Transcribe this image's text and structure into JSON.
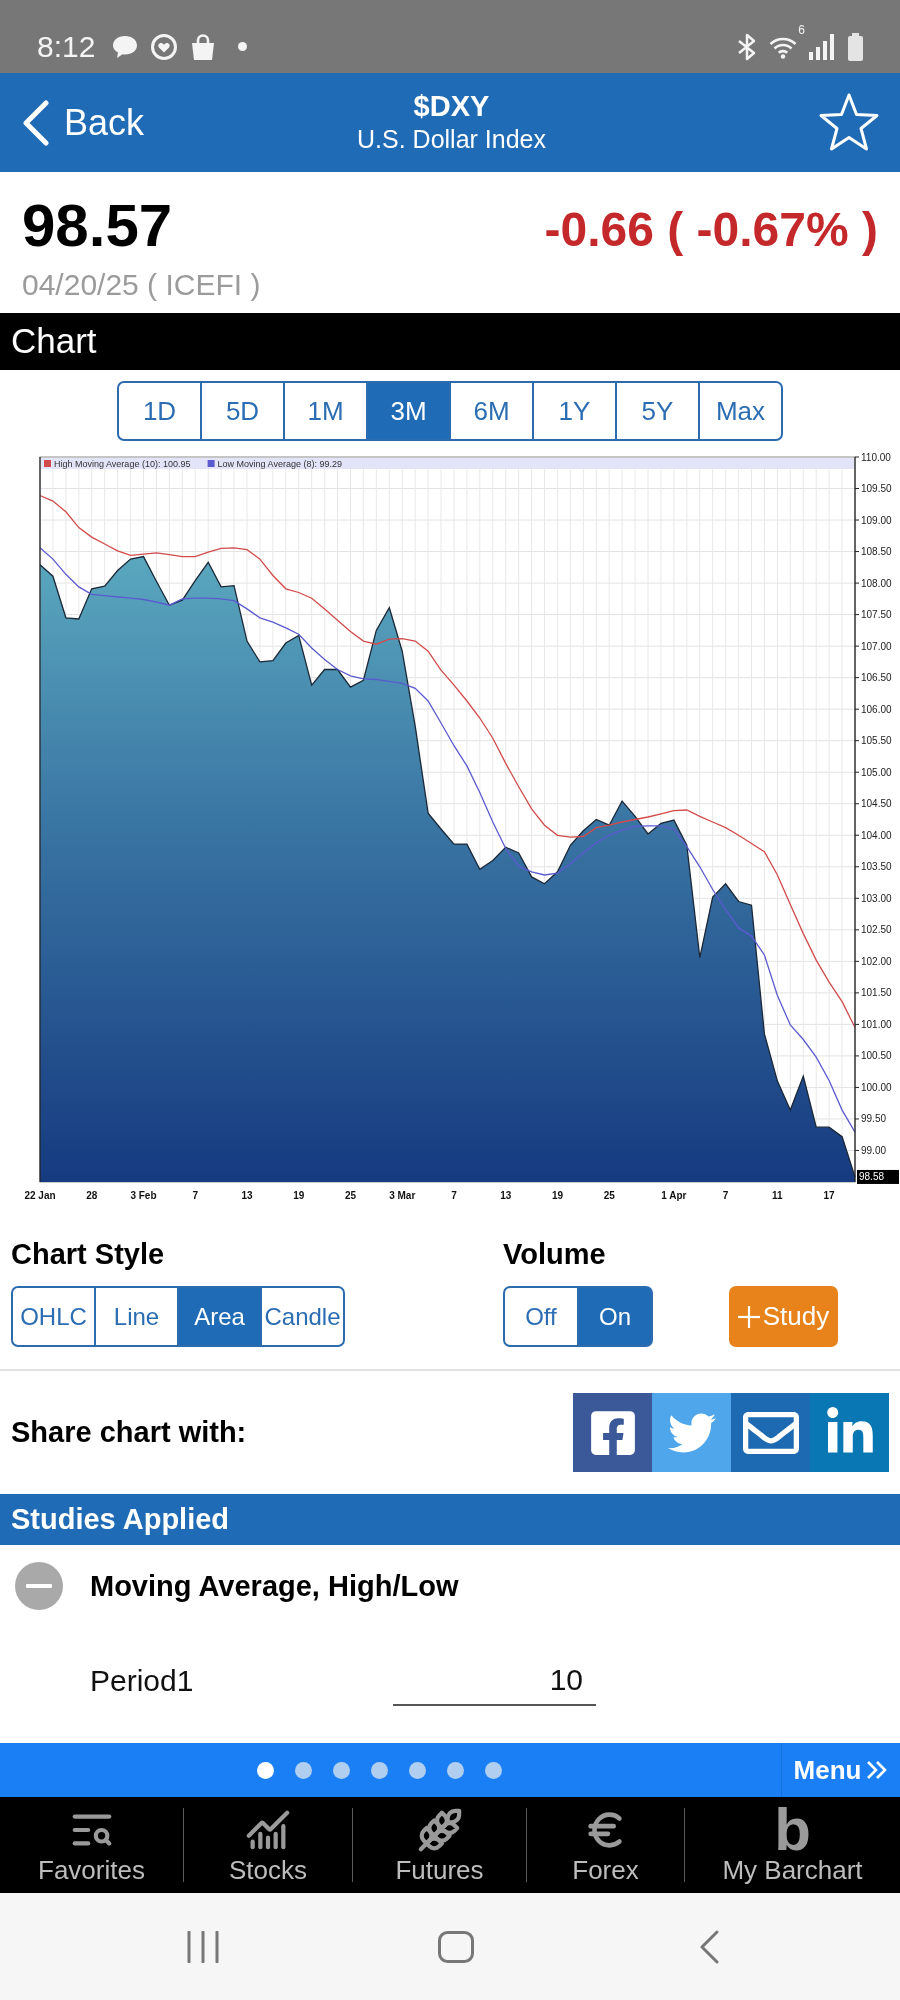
{
  "status_bar": {
    "time": "8:12",
    "wifi_badge": "6"
  },
  "header": {
    "back_label": "Back",
    "symbol": "$DXY",
    "name": "U.S. Dollar Index",
    "favorite": false
  },
  "quote": {
    "price": "98.57",
    "change": "-0.66 ( -0.67% )",
    "negative": true,
    "date_source": "04/20/25 ( ICEFI )"
  },
  "section_title": "Chart",
  "ranges": [
    {
      "label": "1D",
      "selected": false
    },
    {
      "label": "5D",
      "selected": false
    },
    {
      "label": "1M",
      "selected": false
    },
    {
      "label": "3M",
      "selected": true
    },
    {
      "label": "6M",
      "selected": false
    },
    {
      "label": "1Y",
      "selected": false
    },
    {
      "label": "5Y",
      "selected": false
    },
    {
      "label": "Max",
      "selected": false
    }
  ],
  "chart": {
    "chart_data": {
      "type": "area",
      "categories": [
        "22 Jan",
        null,
        null,
        null,
        "28",
        null,
        null,
        null,
        "3 Feb",
        null,
        null,
        null,
        "7",
        null,
        null,
        null,
        "13",
        null,
        null,
        null,
        "19",
        null,
        null,
        null,
        "25",
        null,
        null,
        null,
        "3 Mar",
        null,
        null,
        null,
        "7",
        null,
        null,
        null,
        "13",
        null,
        null,
        null,
        "19",
        null,
        null,
        null,
        "25",
        null,
        null,
        null,
        null,
        "1 Apr",
        null,
        null,
        null,
        "7",
        null,
        null,
        null,
        "11",
        null,
        null,
        null,
        "17",
        null,
        null
      ],
      "series": [
        {
          "values": [
            108.29,
            108.11,
            107.45,
            107.43,
            107.91,
            107.95,
            108.2,
            108.38,
            108.42,
            108.03,
            107.65,
            107.73,
            108.04,
            108.33,
            107.94,
            107.96,
            107.08,
            106.75,
            106.77,
            107.05,
            107.17,
            106.38,
            106.63,
            106.63,
            106.35,
            106.46,
            107.25,
            107.61,
            106.92,
            105.73,
            104.35,
            104.1,
            103.86,
            103.86,
            103.46,
            103.6,
            103.81,
            103.72,
            103.34,
            103.23,
            103.42,
            103.84,
            104.07,
            104.25,
            104.16,
            104.54,
            104.3,
            104.02,
            104.19,
            104.24,
            103.84,
            102.06,
            103.02,
            103.23,
            102.95,
            102.89,
            100.85,
            100.1,
            99.64,
            100.18,
            99.37,
            99.37,
            99.22,
            98.58
          ]
        },
        {
          "type": "line",
          "name": "High Moving Average (10): 100.95",
          "color": "#d24b4b",
          "values": [
            109.39,
            109.3,
            109.13,
            108.88,
            108.73,
            108.62,
            108.51,
            108.44,
            108.46,
            108.48,
            108.45,
            108.42,
            108.42,
            108.49,
            108.55,
            108.56,
            108.53,
            108.38,
            108.12,
            107.91,
            107.85,
            107.76,
            107.59,
            107.41,
            107.23,
            107.08,
            107.03,
            107.11,
            107.12,
            107.08,
            106.92,
            106.62,
            106.38,
            106.13,
            105.86,
            105.54,
            105.14,
            104.77,
            104.42,
            104.16,
            104.0,
            103.97,
            103.98,
            104.12,
            104.16,
            104.21,
            104.25,
            104.29,
            104.34,
            104.39,
            104.4,
            104.3,
            104.21,
            104.12,
            104.0,
            103.87,
            103.74,
            103.37,
            102.9,
            102.44,
            102.02,
            101.67,
            101.36,
            100.95
          ]
        },
        {
          "type": "line",
          "name": "Low Moving Average (8): 99.29",
          "color": "#5b5bd0",
          "values": [
            108.56,
            108.38,
            108.14,
            107.94,
            107.82,
            107.8,
            107.78,
            107.76,
            107.74,
            107.7,
            107.65,
            107.75,
            107.76,
            107.76,
            107.75,
            107.72,
            107.59,
            107.45,
            107.38,
            107.29,
            107.19,
            106.97,
            106.79,
            106.63,
            106.53,
            106.48,
            106.47,
            106.44,
            106.41,
            106.33,
            106.13,
            105.78,
            105.42,
            105.1,
            104.68,
            104.21,
            103.79,
            103.51,
            103.42,
            103.37,
            103.4,
            103.55,
            103.72,
            103.88,
            104.0,
            104.08,
            104.14,
            104.15,
            104.15,
            104.1,
            103.82,
            103.5,
            103.14,
            102.82,
            102.53,
            102.4,
            102.1,
            101.46,
            100.99,
            100.76,
            100.48,
            100.11,
            99.64,
            99.29
          ]
        }
      ],
      "ylim": [
        98.5,
        110
      ],
      "yticks": [
        {
          "value": 99,
          "label": "99.00"
        },
        {
          "value": 99.5,
          "label": "99.50"
        },
        {
          "value": 100,
          "label": "100.00"
        },
        {
          "value": 100.5,
          "label": "100.50"
        },
        {
          "value": 101,
          "label": "101.00"
        },
        {
          "value": 101.5,
          "label": "101.50"
        },
        {
          "value": 102,
          "label": "102.00"
        },
        {
          "value": 102.5,
          "label": "102.50"
        },
        {
          "value": 103,
          "label": "103.00"
        },
        {
          "value": 103.5,
          "label": "103.50"
        },
        {
          "value": 104,
          "label": "104.00"
        },
        {
          "value": 104.5,
          "label": "104.50"
        },
        {
          "value": 105,
          "label": "105.00"
        },
        {
          "value": 105.5,
          "label": "105.50"
        },
        {
          "value": 106,
          "label": "106.00"
        },
        {
          "value": 106.5,
          "label": "106.50"
        },
        {
          "value": 107,
          "label": "107.00"
        },
        {
          "value": 107.5,
          "label": "107.50"
        },
        {
          "value": 108,
          "label": "108.00"
        },
        {
          "value": 108.5,
          "label": "108.50"
        },
        {
          "value": 109,
          "label": "109.00"
        },
        {
          "value": 109.5,
          "label": "109.50"
        },
        {
          "value": 110,
          "label": "110.00"
        }
      ],
      "grid": true,
      "legend": "top-left",
      "annotations": [
        "98.58"
      ]
    }
  },
  "chart_style": {
    "label": "Chart Style",
    "options": [
      {
        "label": "OHLC",
        "selected": false
      },
      {
        "label": "Line",
        "selected": false
      },
      {
        "label": "Area",
        "selected": true
      },
      {
        "label": "Candle",
        "selected": false
      }
    ]
  },
  "volume": {
    "label": "Volume",
    "options": [
      {
        "label": "Off",
        "selected": false
      },
      {
        "label": "On",
        "selected": true
      }
    ]
  },
  "study_button": {
    "label": "Study"
  },
  "share": {
    "label": "Share chart with:",
    "targets": [
      {
        "kind": "facebook",
        "color": "#3b5998"
      },
      {
        "kind": "twitter",
        "color": "#4fa6ea"
      },
      {
        "kind": "email",
        "color": "#1e6ab2"
      },
      {
        "kind": "linkedin",
        "color": "#0a77b5"
      }
    ]
  },
  "studies": {
    "title": "Studies Applied",
    "items": [
      {
        "name": "Moving Average, High/Low",
        "params": [
          {
            "label": "Period1",
            "value": "10"
          }
        ]
      }
    ]
  },
  "pager": {
    "pages": [
      {
        "selected": true
      },
      {
        "selected": false
      },
      {
        "selected": false
      },
      {
        "selected": false
      },
      {
        "selected": false
      },
      {
        "selected": false
      },
      {
        "selected": false
      }
    ],
    "menu_label": "Menu"
  },
  "tab_bar": [
    {
      "kind": "favorites",
      "label": "Favorites"
    },
    {
      "kind": "stocks",
      "label": "Stocks"
    },
    {
      "kind": "futures",
      "label": "Futures"
    },
    {
      "kind": "forex",
      "label": "Forex"
    },
    {
      "kind": "logo",
      "label": "My Barchart",
      "glyph": "b"
    }
  ]
}
